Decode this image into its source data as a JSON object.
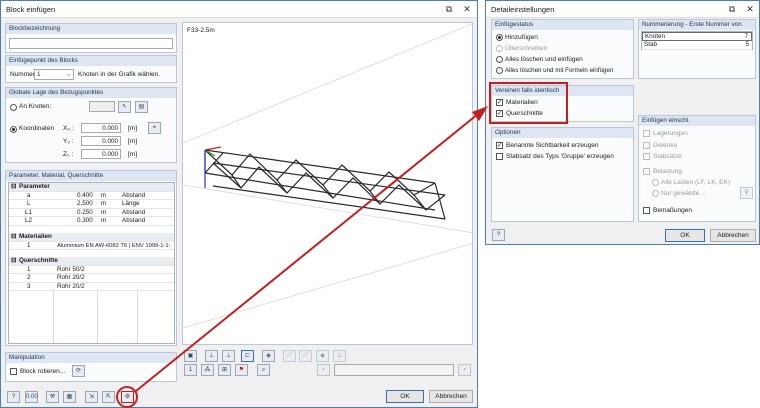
{
  "left": {
    "title": "Block einfügen",
    "sections": {
      "name": "Blockbezeichnung",
      "insert": "Einfügepunkt des Blocks",
      "position": "Globale Lage des Bezugspunktes",
      "params": "Parameter, Material, Querschnitte",
      "manip": "Manipulation"
    },
    "nummer_label": "Nummer:",
    "nummer_value": "1",
    "nummer_hint": "Knoten in der Grafik wählen.",
    "an_knoten": "An Knoten:",
    "koordinaten": "Koordinaten",
    "coords": [
      {
        "label": "X₀ :",
        "value": "0.000",
        "unit": "[m]"
      },
      {
        "label": "Y₀ :",
        "value": "0.000",
        "unit": "[m]"
      },
      {
        "label": "Z₀ :",
        "value": "0.000",
        "unit": "[m]"
      }
    ],
    "table": {
      "parameter_head": "Parameter",
      "params": [
        {
          "name": "a",
          "value": "0.400",
          "unit": "m",
          "desc": "Abstand"
        },
        {
          "name": "L",
          "value": "2.500",
          "unit": "m",
          "desc": "Länge"
        },
        {
          "name": "L1",
          "value": "0.250",
          "unit": "m",
          "desc": "Abstand"
        },
        {
          "name": "L2",
          "value": "0.300",
          "unit": "m",
          "desc": "Abstand"
        }
      ],
      "mat_head": "Materialien",
      "materials": [
        {
          "no": "1",
          "name": "Aluminium EN AW-6082 T6 | ENV 1999-1-1:"
        }
      ],
      "qs_head": "Querschnitte",
      "sections": [
        {
          "no": "1",
          "name": "Rohr 50/2"
        },
        {
          "no": "2",
          "name": "Rohr 20/2"
        },
        {
          "no": "3",
          "name": "Rohr 20/2"
        }
      ]
    },
    "rotate_label": "Block rotieren...",
    "viewport_label": "F33-2.5m",
    "ok": "OK",
    "cancel": "Abbrechen"
  },
  "right": {
    "title": "Detaileinstellungen",
    "status_head": "Einfügestatus",
    "status_opts": [
      "Hinzufügen",
      "Überschreiben",
      "Alles löschen und einfügen",
      "Alles löschen und mit Formeln einfügen"
    ],
    "numbering_head": "Nummerierung - Erste Nummer von",
    "numbering": [
      {
        "name": "Knoten",
        "value": "7"
      },
      {
        "name": "Stab",
        "value": "5"
      }
    ],
    "unite_head": "Vereinen falls identisch",
    "unite_opts": [
      "Materialien",
      "Querschnitte"
    ],
    "options_head": "Optionen",
    "options": [
      "Benannte Sichtbarkeit erzeugen",
      "Stabsatz des Typs 'Gruppe' erzeugen"
    ],
    "include_head": "Einfügen einschl.",
    "include_opts": [
      "Lagerungen",
      "Gelenke",
      "Stabsätze",
      "Belastung"
    ],
    "load_opts": [
      "Alle Lasten (LF, LK, EK)",
      "Nur gewählte ..."
    ],
    "dims": "Bemaßungen",
    "ok": "OK",
    "cancel": "Abbrechen"
  },
  "colors": {
    "accent": "#c41f1f",
    "title_border": "#4a7eb5"
  }
}
